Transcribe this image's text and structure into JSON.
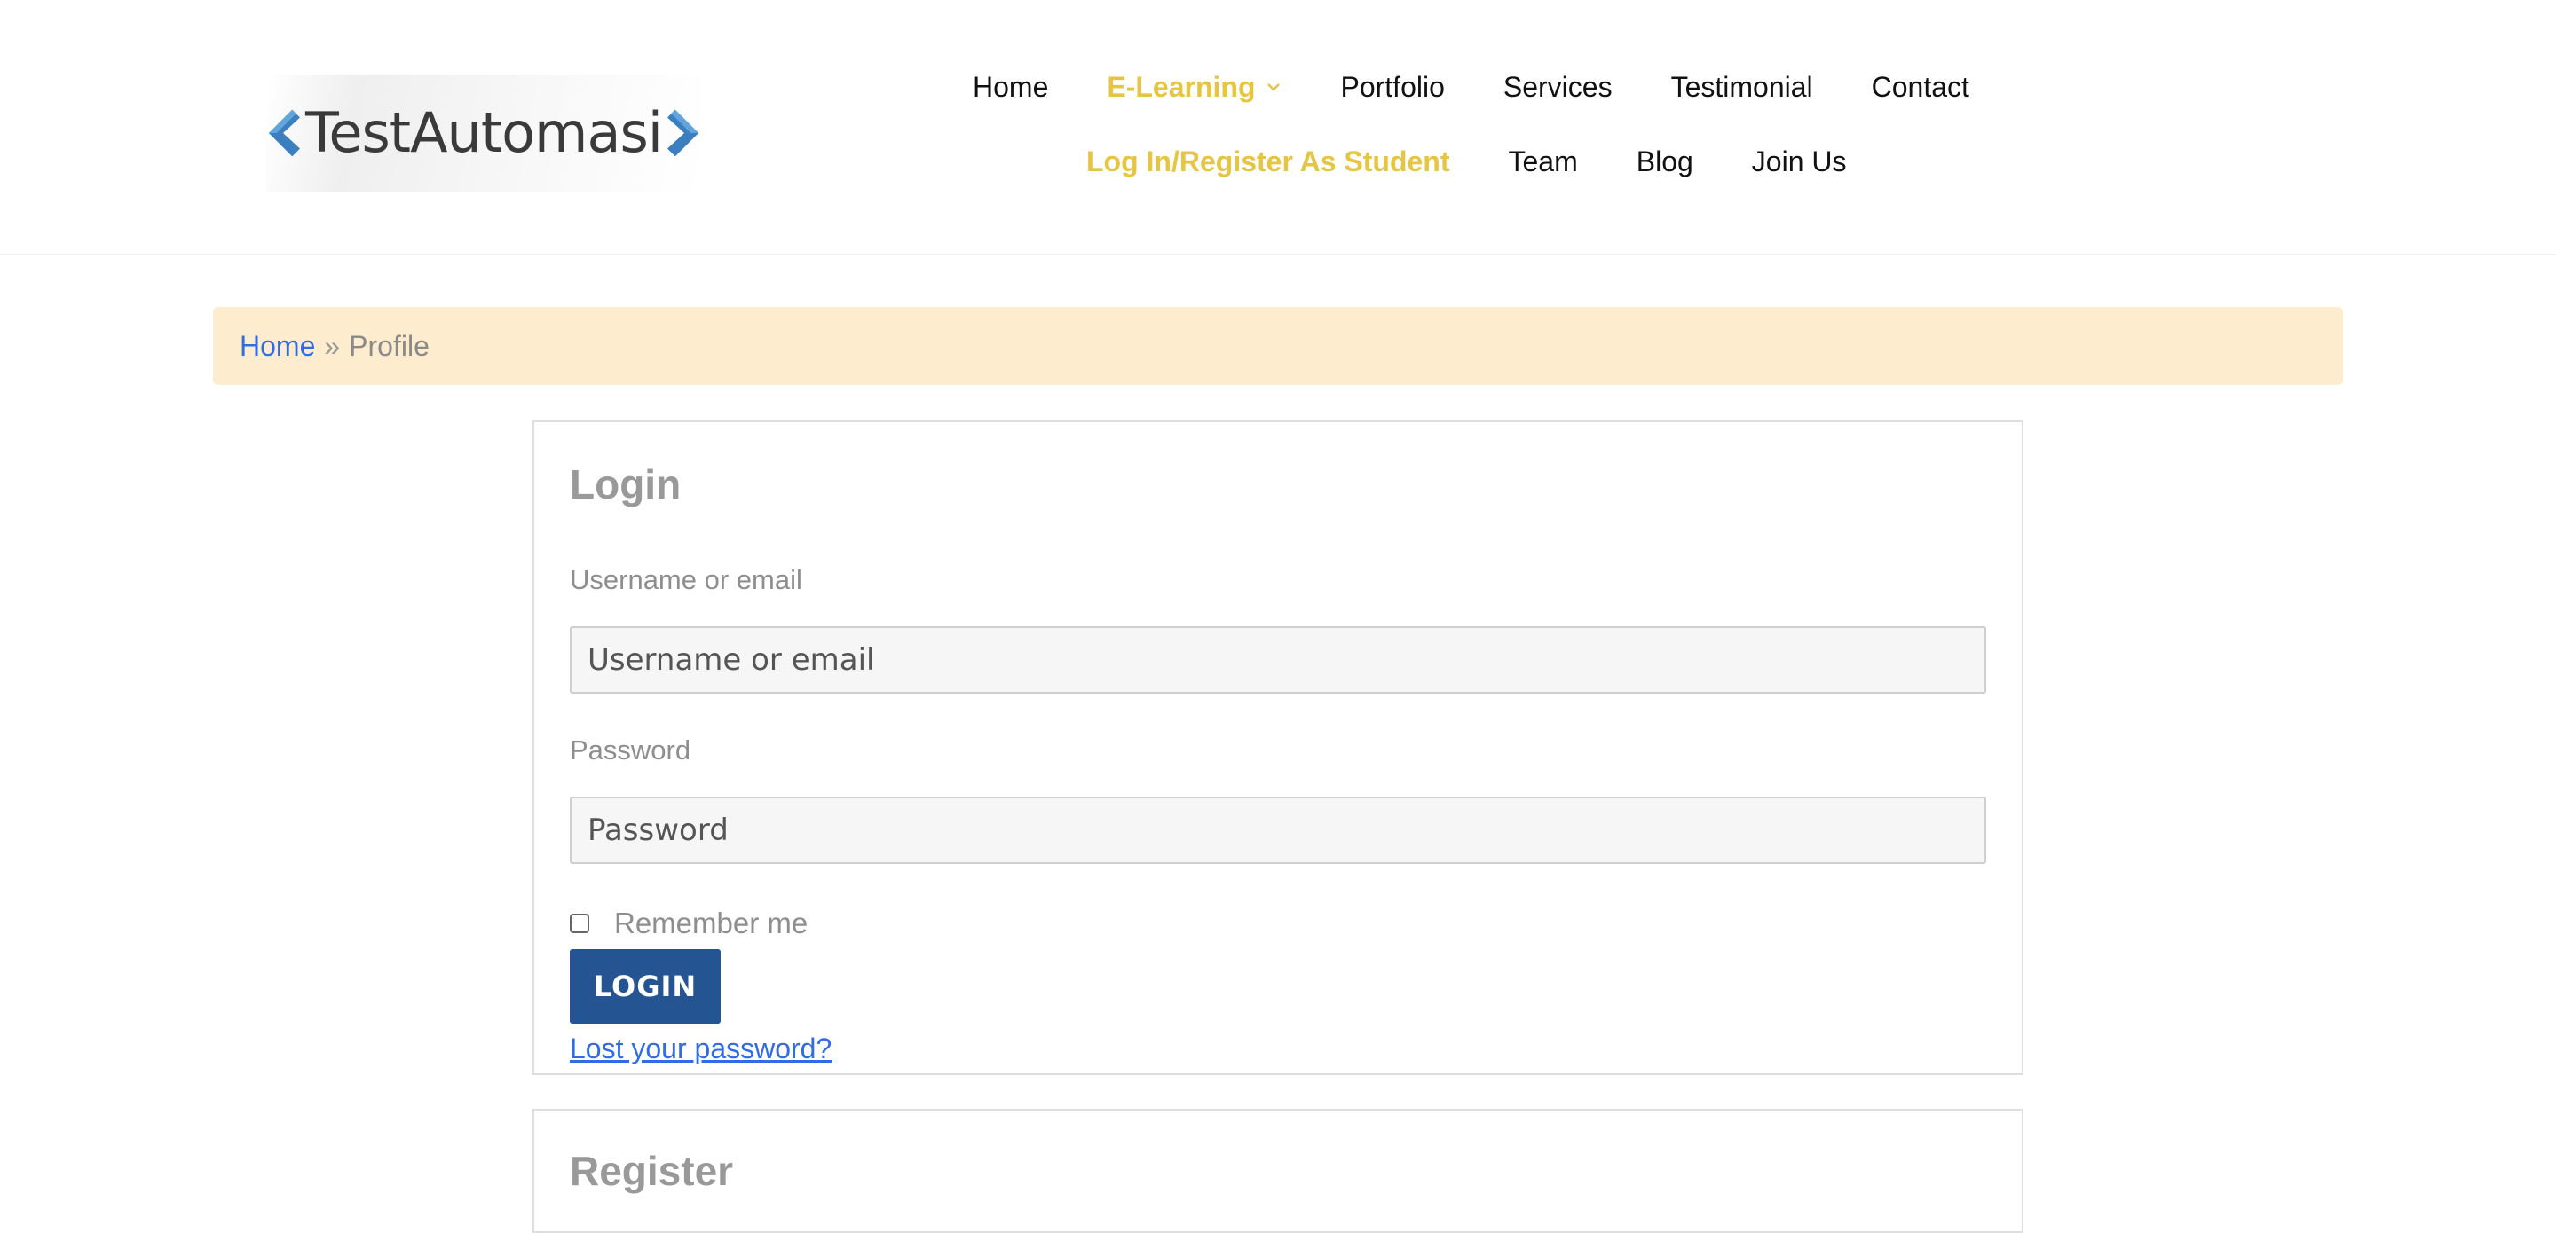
{
  "brand": {
    "name": "TestAutomasi",
    "accent": "#e6c542",
    "link_color": "#2f6ce5",
    "button_color": "#245491"
  },
  "nav": {
    "row1": [
      {
        "label": "Home",
        "highlight": false
      },
      {
        "label": "E-Learning",
        "highlight": true,
        "dropdown": true
      },
      {
        "label": "Portfolio",
        "highlight": false
      },
      {
        "label": "Services",
        "highlight": false
      },
      {
        "label": "Testimonial",
        "highlight": false
      },
      {
        "label": "Contact",
        "highlight": false
      }
    ],
    "row2": [
      {
        "label": "Log In/Register As Student",
        "highlight": true
      },
      {
        "label": "Team",
        "highlight": false
      },
      {
        "label": "Blog",
        "highlight": false
      },
      {
        "label": "Join Us",
        "highlight": false
      }
    ]
  },
  "breadcrumb": {
    "home": "Home",
    "separator": "»",
    "current": "Profile"
  },
  "login": {
    "title": "Login",
    "username_label": "Username or email",
    "username_placeholder": "Username or email",
    "username_value": "",
    "password_label": "Password",
    "password_placeholder": "Password",
    "password_value": "",
    "remember_label": "Remember me",
    "remember_checked": false,
    "button_label": "LOGIN",
    "lost_password": "Lost your password?"
  },
  "register": {
    "title": "Register"
  }
}
